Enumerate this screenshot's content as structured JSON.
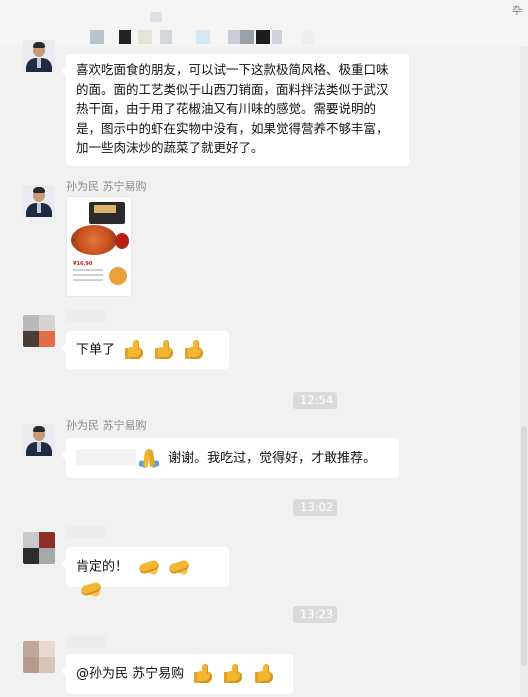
{
  "header": {
    "pin_icon": "pin-icon",
    "pin_glyph": "卆"
  },
  "messages": [
    {
      "id": "m1",
      "sender": "",
      "text": "喜欢吃面食的朋友，可以试一下这款极简风格、极重口味的面。面的工艺类似于山西刀销面，面料拌法类似于武汉热干面，由于用了花椒油又有川味的感觉。需要说明的是，图示中的虾在实物中没有，如果觉得营养不够丰富，加一些肉沫炒的蔬菜了就更好了。"
    },
    {
      "id": "m2",
      "sender": "孙为民 苏宁易购",
      "type": "image",
      "image_desc_icon": "noodle-product-image",
      "price_text": "¥16.90"
    },
    {
      "id": "m3",
      "sender": "",
      "text": "下单了",
      "emojis": [
        "thumbs-up-icon",
        "thumbs-up-icon",
        "thumbs-up-icon"
      ]
    },
    {
      "id": "t1",
      "type": "time",
      "text": "12:54"
    },
    {
      "id": "m4",
      "sender": "孙为民 苏宁易购",
      "text": "谢谢。我吃过，觉得好，才敢推荐。",
      "emojis_before": [
        "praying-hands-icon"
      ]
    },
    {
      "id": "t2",
      "type": "time",
      "text": "13:02"
    },
    {
      "id": "m5",
      "sender": "",
      "text": "肯定的！",
      "emojis": [
        "handshake-icon",
        "handshake-icon",
        "handshake-icon"
      ]
    },
    {
      "id": "t3",
      "type": "time",
      "text": "13:23"
    },
    {
      "id": "m6",
      "sender": "",
      "text": "@孙为民 苏宁易购",
      "emojis": [
        "thumbs-up-icon",
        "thumbs-up-icon",
        "thumbs-up-icon"
      ]
    }
  ],
  "colors": {
    "background": "#f1f1f1",
    "bubble": "#ffffff",
    "timestamp_bg": "#dadada",
    "sender_text": "#8a8a8a"
  }
}
